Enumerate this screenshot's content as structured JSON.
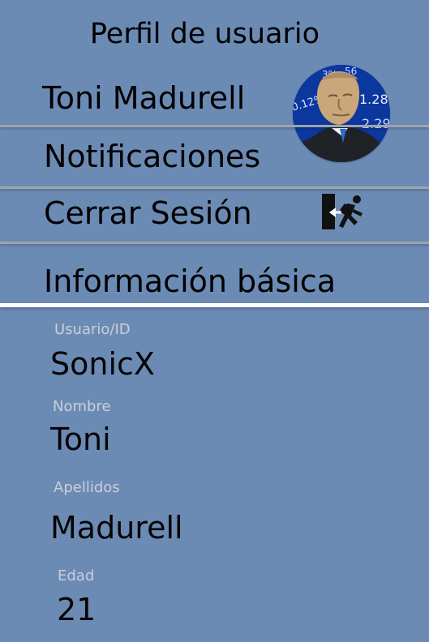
{
  "header": {
    "title": "Perfil de usuario"
  },
  "profile": {
    "name": "Toni Madurell",
    "avatar_icon": "meme-avatar"
  },
  "menu": {
    "notifications": "Notificaciones",
    "logout": "Cerrar Sesión",
    "logout_icon": "exit-door-icon"
  },
  "basic_info": {
    "title": "Información básica",
    "fields": [
      {
        "label": "Usuario/ID",
        "value": "SonicX"
      },
      {
        "label": "Nombre",
        "value": "Toni"
      },
      {
        "label": "Apellidos",
        "value": "Madurell"
      },
      {
        "label": "Edad",
        "value": "21"
      }
    ]
  },
  "colors": {
    "background": "#6c8bb4",
    "divider": "#9ea4aa",
    "section_divider": "#ffffff",
    "label": "#c8d0da"
  }
}
